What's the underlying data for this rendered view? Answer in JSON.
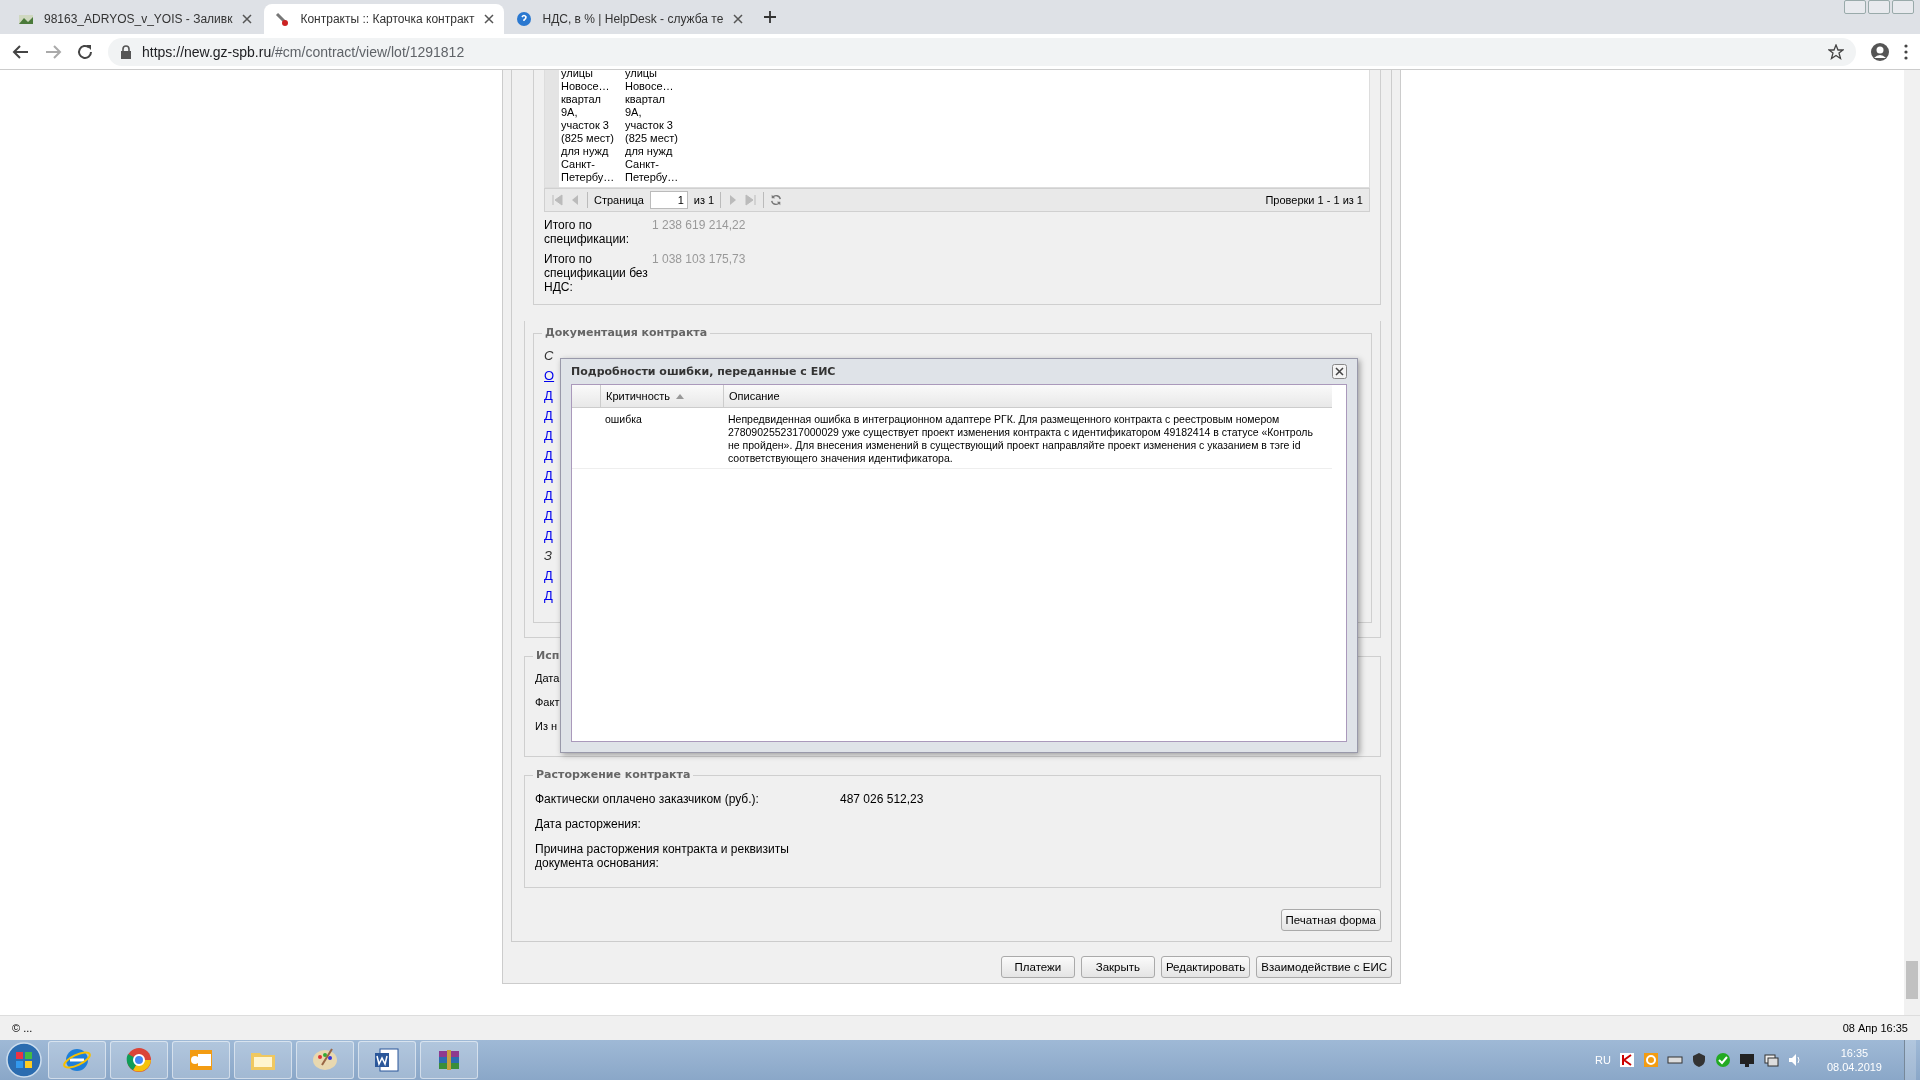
{
  "browser": {
    "tabs": [
      {
        "title": "98163_ADRYOS_v_YOIS - Заливк",
        "selected": false
      },
      {
        "title": "Контракты :: Карточка контракт",
        "selected": true
      },
      {
        "title": "НДС, в % | HelpDesk - служба те",
        "selected": false
      }
    ],
    "url_host": "https://new.gz-spb.ru",
    "url_path": "/#cm/contract/view/lot/1291812"
  },
  "spec_grid": {
    "cells": [
      "улицы\nНовосе…\nквартал\n9А,\nучасток 3\n(825 мест)\nдля нужд\nСанкт-\nПетербу…",
      "улицы\nНовосе…\nквартал\n9А,\nучасток 3\n(825 мест)\nдля нужд\nСанкт-\nПетербу…"
    ],
    "pager": {
      "page_label": "Страница",
      "page": "1",
      "of": "из 1",
      "summary": "Проверки 1 - 1 из 1"
    }
  },
  "totals": [
    {
      "label": "Итого по спецификации:",
      "value": "1 238 619 214,22"
    },
    {
      "label": "Итого по спецификации без НДС:",
      "value": "1 038 103 175,73"
    }
  ],
  "docs": {
    "legend": "Документация контракта",
    "items": [
      {
        "kind": "note",
        "text": "С"
      },
      {
        "kind": "link",
        "text": "О"
      },
      {
        "kind": "link",
        "text": "Д"
      },
      {
        "kind": "link",
        "text": "Д"
      },
      {
        "kind": "link",
        "text": "Д"
      },
      {
        "kind": "link",
        "text": "Д"
      },
      {
        "kind": "link",
        "text": "Д"
      },
      {
        "kind": "link",
        "text": "Д"
      },
      {
        "kind": "link",
        "text": "Д"
      },
      {
        "kind": "link",
        "text": "Д"
      },
      {
        "kind": "note",
        "text": "З"
      },
      {
        "kind": "link",
        "text": "Д"
      },
      {
        "kind": "link",
        "text": "Д"
      }
    ]
  },
  "execution": {
    "legend": "Исп",
    "rows": [
      "Дата",
      "Факт",
      "Из н"
    ]
  },
  "termination": {
    "legend": "Расторжение контракта",
    "rows": [
      {
        "label": "Фактически оплачено заказчиком (руб.):",
        "value": "487 026 512,23"
      },
      {
        "label": "Дата расторжения:"
      },
      {
        "label": "Причина расторжения контракта и реквизиты документа основания:"
      }
    ]
  },
  "print_button": "Печатная форма",
  "buttons": [
    "Платежи",
    "Закрыть",
    "Редактировать",
    "Взаимодействие с ЕИС"
  ],
  "dialog": {
    "title": "Подробности ошибки, переданные с ЕИС",
    "columns": [
      {
        "label": "Критичность",
        "sorted": true
      },
      {
        "label": "Описание",
        "sorted": false
      }
    ],
    "rows": [
      {
        "severity": "ошибка",
        "description": "Непредвиденная ошибка в интеграционном адаптере РГК. Для размещенного контракта с реестровым номером 2780902552317000029 уже существует проект изменения контракта с идентификатором 49182414 в статусе «Контроль не пройден». Для внесения изменений в существующий проект направляйте проект изменения с указанием в тэге id соответствующего значения идентификатора."
      }
    ]
  },
  "status_bar": {
    "left": "© ...",
    "right": "08 Апр 16:35"
  },
  "taskbar": {
    "apps": [
      {
        "kind": "ie"
      },
      {
        "kind": "chrome"
      },
      {
        "kind": "outlook"
      },
      {
        "kind": "folder"
      },
      {
        "kind": "paint"
      },
      {
        "kind": "word"
      },
      {
        "kind": "archive"
      }
    ],
    "language": "RU",
    "tray": [
      {
        "kind": "k"
      },
      {
        "kind": "o"
      },
      {
        "kind": "drive"
      },
      {
        "kind": "shield"
      },
      {
        "kind": "check"
      },
      {
        "kind": "monitor"
      },
      {
        "kind": "network"
      },
      {
        "kind": "speaker"
      }
    ],
    "time": "16:35",
    "date": "08.04.2019"
  }
}
